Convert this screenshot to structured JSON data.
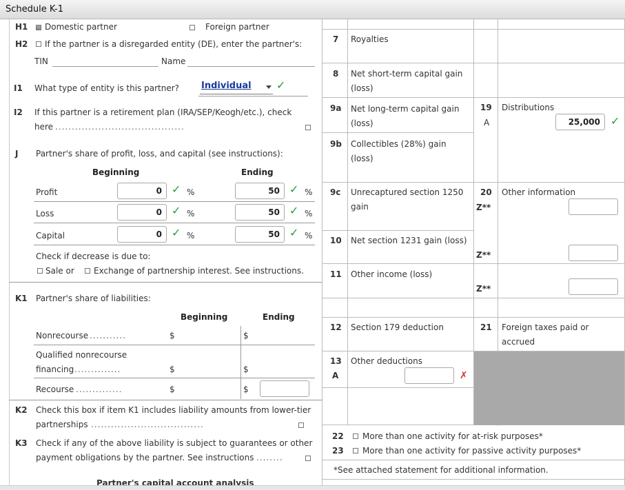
{
  "window": {
    "title": "Schedule K-1"
  },
  "left": {
    "h1": {
      "code": "H1",
      "domestic": "Domestic partner",
      "foreign": "Foreign partner"
    },
    "h2": {
      "code": "H2",
      "text": "If the partner is a disregarded entity (DE), enter the partner's:",
      "tin": "TIN",
      "name": "Name"
    },
    "i1": {
      "code": "I1",
      "text": "What type of entity is this partner?",
      "value": "Individual"
    },
    "i2": {
      "code": "I2",
      "text": "If this partner is a retirement plan (IRA/SEP/Keogh/etc.), check",
      "text2": "here"
    },
    "j": {
      "code": "J",
      "text": "Partner's share of profit, loss, and capital (see instructions):",
      "beginning": "Beginning",
      "ending": "Ending",
      "pct": "%",
      "rows": [
        {
          "label": "Profit",
          "beginning": "0",
          "ending": "50"
        },
        {
          "label": "Loss",
          "beginning": "0",
          "ending": "50"
        },
        {
          "label": "Capital",
          "beginning": "0",
          "ending": "50"
        }
      ],
      "decrease": "Check if decrease is due to:",
      "sale": "Sale or",
      "exchange": "Exchange of partnership interest. See instructions."
    },
    "k1": {
      "code": "K1",
      "text": "Partner's share of liabilities:",
      "beginning": "Beginning",
      "ending": "Ending",
      "dollar": "$",
      "nonrecourse": "Nonrecourse",
      "qualified1": "Qualified nonrecourse",
      "qualified2": "financing",
      "recourse": "Recourse"
    },
    "k2": {
      "code": "K2",
      "text": "Check this box if item K1 includes liability amounts from lower-tier",
      "text2": "partnerships"
    },
    "k3": {
      "code": "K3",
      "text": "Check if any of the above liability is subject to guarantees or other",
      "text2": "payment obligations by the partner. See instructions"
    },
    "footer_cut": "Partner's capital account analysis"
  },
  "middle": {
    "l7": {
      "code": "7",
      "label": "Royalties"
    },
    "l8": {
      "code": "8",
      "label1": "Net short-term capital gain",
      "label2": "(loss)"
    },
    "l9a": {
      "code": "9a",
      "label1": "Net long-term capital gain",
      "label2": "(loss)"
    },
    "l9b": {
      "code": "9b",
      "label1": "Collectibles (28%) gain",
      "label2": "(loss)"
    },
    "l9c": {
      "code": "9c",
      "label1": "Unrecaptured section 1250",
      "label2": "gain"
    },
    "l10": {
      "code": "10",
      "label": "Net section 1231 gain (loss)"
    },
    "l11": {
      "code": "11",
      "label": "Other income (loss)"
    },
    "l12": {
      "code": "12",
      "label": "Section 179 deduction"
    },
    "l13": {
      "code": "13",
      "label": "Other deductions",
      "sub": "A"
    },
    "l22": {
      "code": "22",
      "label": "More than one activity for at-risk purposes*"
    },
    "l23": {
      "code": "23",
      "label": "More than one activity for passive activity purposes*"
    },
    "note": "*See attached statement for additional information."
  },
  "right": {
    "l19": {
      "code": "19",
      "label": "Distributions",
      "sub": "A",
      "value": "25,000"
    },
    "l20": {
      "code": "20",
      "label": "Other information",
      "z": "Z**"
    },
    "l21": {
      "code": "21",
      "label1": "Foreign taxes paid or",
      "label2": "accrued"
    }
  }
}
